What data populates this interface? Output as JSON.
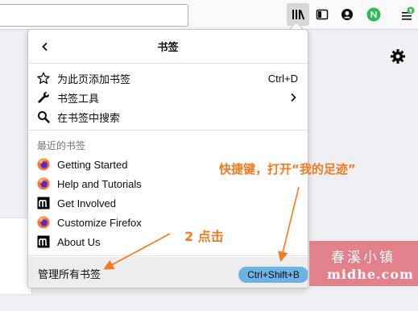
{
  "panel": {
    "title": "书签",
    "top_items": [
      {
        "label": "为此页添加书签",
        "shortcut": "Ctrl+D",
        "icon": "star-icon"
      },
      {
        "label": "书签工具",
        "icon": "wrench-icon",
        "submenu": true
      },
      {
        "label": "在书签中搜索",
        "icon": "search-icon"
      }
    ],
    "recent_label": "最近的书签",
    "recent_items": [
      {
        "label": "Getting Started",
        "icon": "firefox-icon"
      },
      {
        "label": "Help and Tutorials",
        "icon": "firefox-icon"
      },
      {
        "label": "Get Involved",
        "icon": "mozilla-m-icon"
      },
      {
        "label": "Customize Firefox",
        "icon": "firefox-icon"
      },
      {
        "label": "About Us",
        "icon": "mozilla-m-icon"
      }
    ],
    "footer_label": "管理所有书签",
    "footer_shortcut": "Ctrl+Shift+B"
  },
  "annotations": {
    "shortcut_note": "快捷键，打开“我的足迹”",
    "step_note": "2 点击"
  },
  "watermark": {
    "line1": "春溪小镇",
    "line2": "midhe.com"
  },
  "colors": {
    "annotation": "#f47a20",
    "shortcut_highlight": "#6cb3e5",
    "watermark_bg": "#e2808b",
    "extension_badge": "#2bbd55",
    "update_badge": "#39b54a"
  }
}
